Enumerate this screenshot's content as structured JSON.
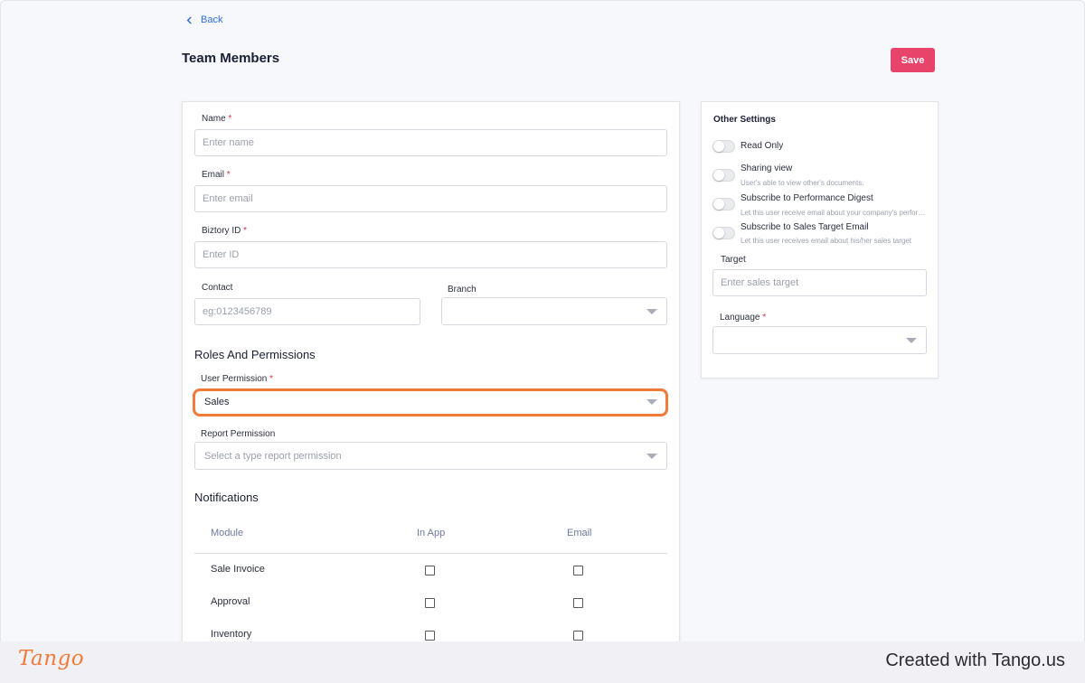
{
  "header": {
    "back_label": "Back",
    "page_title": "Team Members",
    "save_label": "Save"
  },
  "form": {
    "name": {
      "label": "Name",
      "required": "*",
      "placeholder": "Enter name"
    },
    "email": {
      "label": "Email",
      "required": "*",
      "placeholder": "Enter email"
    },
    "biztory_id": {
      "label": "Biztory ID",
      "required": "*",
      "placeholder": "Enter ID"
    },
    "contact": {
      "label": "Contact",
      "placeholder": "eg:0123456789"
    },
    "branch": {
      "label": "Branch",
      "value": ""
    }
  },
  "roles": {
    "section_title": "Roles And Permissions",
    "user_permission": {
      "label": "User Permission",
      "required": "*",
      "value": "Sales"
    },
    "report_permission": {
      "label": "Report Permission",
      "placeholder": "Select a type report permission"
    }
  },
  "notifications": {
    "section_title": "Notifications",
    "columns": [
      "Module",
      "In App",
      "Email"
    ],
    "rows": [
      {
        "module": "Sale Invoice",
        "in_app": false,
        "email": false
      },
      {
        "module": "Approval",
        "in_app": false,
        "email": false
      },
      {
        "module": "Inventory",
        "in_app": false,
        "email": false
      }
    ]
  },
  "other_settings": {
    "title": "Other Settings",
    "options": [
      {
        "label": "Read Only",
        "description": "",
        "enabled": false
      },
      {
        "label": "Sharing view",
        "description": "User's able to view other's documents.",
        "enabled": false
      },
      {
        "label": "Subscribe to Performance Digest",
        "description": "Let this user receive email about your company's performance digest",
        "enabled": false
      },
      {
        "label": "Subscribe to Sales Target Email",
        "description": "Let this user receives email about his/her sales target",
        "enabled": false
      }
    ],
    "target": {
      "label": "Target",
      "placeholder": "Enter sales target"
    },
    "language": {
      "label": "Language",
      "required": "*",
      "value": ""
    }
  },
  "footer": {
    "logo_text": "Tango",
    "created_text": "Created with Tango.us"
  },
  "colors": {
    "accent": "#e8436b",
    "highlight": "#ef7a3a",
    "link": "#2f6fd6"
  }
}
